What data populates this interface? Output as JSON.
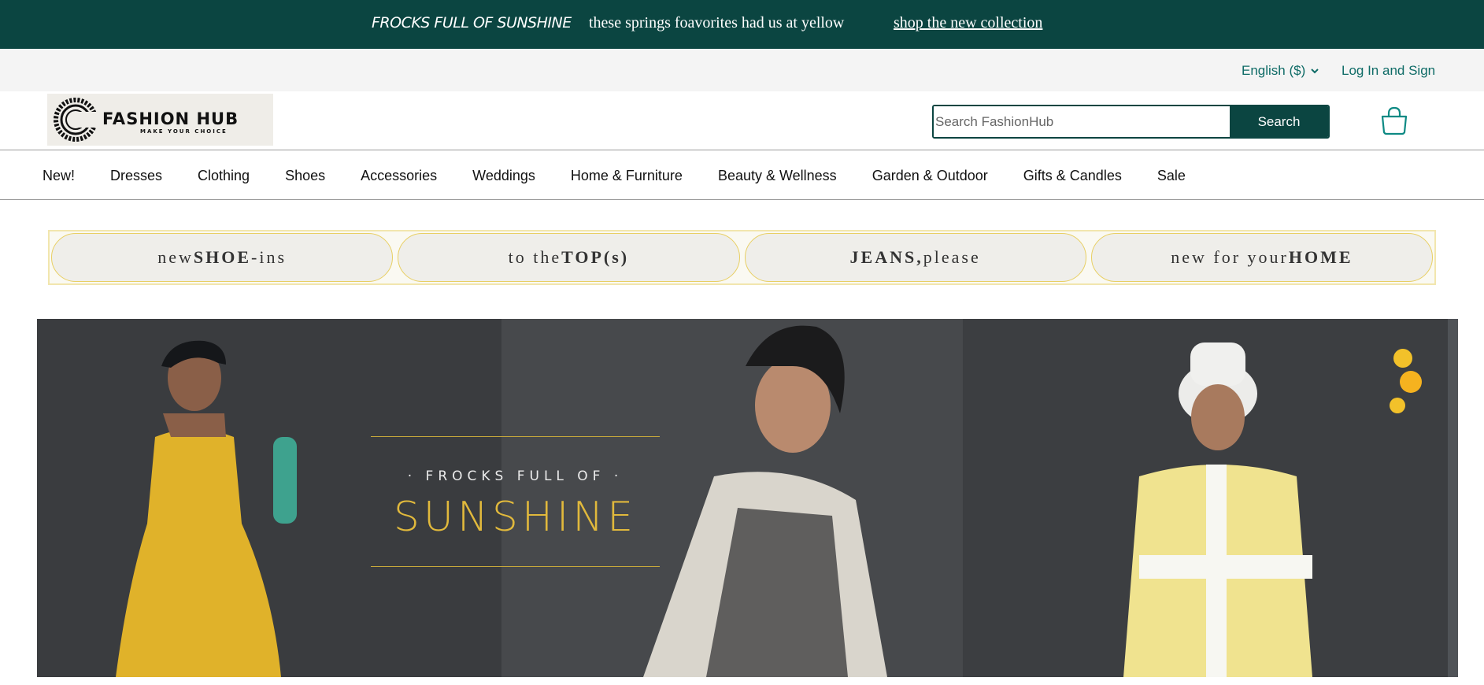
{
  "promo": {
    "headline": "FROCKS FULL OF SUNSHINE",
    "message": "these springs foavorites had us at yellow",
    "link": "shop the new collection"
  },
  "utility": {
    "language": "English ($)",
    "login": "Log In and Sign"
  },
  "header": {
    "logo_name": "FASHION HUB",
    "logo_tagline": "MAKE YOUR CHOICE",
    "search_placeholder": "Search FashionHub",
    "search_button": "Search",
    "cart_icon": "shopping-bag-icon"
  },
  "nav": {
    "items": [
      "New!",
      "Dresses",
      "Clothing",
      "Shoes",
      "Accessories",
      "Weddings",
      "Home & Furniture",
      "Beauty & Wellness",
      "Garden & Outdoor",
      "Gifts & Candles",
      "Sale"
    ]
  },
  "categories": [
    {
      "pre": "new ",
      "bold": "SHOE",
      "post": "-ins"
    },
    {
      "pre": "to the ",
      "bold": "TOP(s)",
      "post": ""
    },
    {
      "pre": "",
      "bold": "JEANS,",
      "post": " please"
    },
    {
      "pre": "new for your ",
      "bold": "HOME",
      "post": ""
    }
  ],
  "hero": {
    "subtitle": "· FROCKS FULL OF ·",
    "title": "SUNSHINE"
  },
  "colors": {
    "brand": "#0b4541",
    "link": "#0e6b66",
    "hero_accent": "#e1b93c"
  }
}
